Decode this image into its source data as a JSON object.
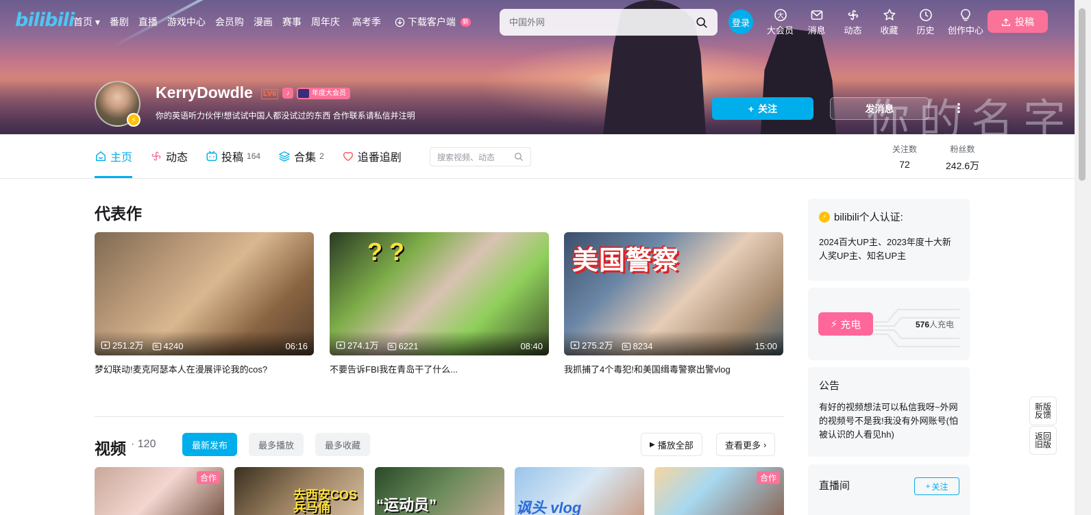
{
  "nav": {
    "logo": "bilibili",
    "links": [
      "首页",
      "番剧",
      "直播",
      "游戏中心",
      "会员购",
      "漫画",
      "赛事",
      "周年庆",
      "高考季"
    ],
    "download": "下载客户端",
    "download_badge": "新",
    "search_placeholder": "中国外网",
    "login": "登录",
    "right_items": [
      "大会员",
      "消息",
      "动态",
      "收藏",
      "历史",
      "创作中心"
    ],
    "upload": "投稿"
  },
  "banner": {
    "overlay_text": "你的名字"
  },
  "profile": {
    "name": "KerryDowdle",
    "level": "LV6",
    "vip": "年度大会员",
    "sign": "你的英语听力伙伴!想试试中国人都没试过的东西 合作联系请私信并注明",
    "follow": "关注",
    "message": "发消息"
  },
  "tabs": [
    {
      "label": "主页",
      "count": ""
    },
    {
      "label": "动态",
      "count": ""
    },
    {
      "label": "投稿",
      "count": "164"
    },
    {
      "label": "合集",
      "count": "2"
    },
    {
      "label": "追番追剧",
      "count": ""
    }
  ],
  "tab_search_placeholder": "搜索视频、动态",
  "stats": {
    "following_label": "关注数",
    "following": "72",
    "fans_label": "粉丝数",
    "fans": "242.6万"
  },
  "featured": {
    "title": "代表作",
    "items": [
      {
        "plays": "251.2万",
        "danmaku": "4240",
        "duration": "06:16",
        "title": "梦幻联动!麦克阿瑟本人在漫展评论我的cos?"
      },
      {
        "plays": "274.1万",
        "danmaku": "6221",
        "duration": "08:40",
        "title": "不要告诉FBI我在青岛干了什么..."
      },
      {
        "plays": "275.2万",
        "danmaku": "8234",
        "duration": "15:00",
        "title": "我抓捕了4个毒犯!和美国缉毒警察出警vlog",
        "overlay": "美国警察"
      }
    ]
  },
  "videos": {
    "title": "视频",
    "count": "120",
    "sort": [
      "最新发布",
      "最多播放",
      "最多收藏"
    ],
    "play_all": "播放全部",
    "more": "查看更多",
    "thumbs": [
      {
        "tag": "合作",
        "overlay": ""
      },
      {
        "tag": "",
        "overlay": "去西安COS兵马俑"
      },
      {
        "tag": "",
        "overlay": "“运动员”"
      },
      {
        "tag": "",
        "overlay": "讽头 vlog"
      },
      {
        "tag": "合作",
        "overlay": ""
      }
    ]
  },
  "sidebar": {
    "cert_title": "bilibili个人认证:",
    "cert_body": "2024百大UP主、2023年度十大新人奖UP主、知名UP主",
    "charge": "充电",
    "charge_count": "576",
    "charge_suffix": "人充电",
    "notice_title": "公告",
    "notice_body": "有好的视频想法可以私信我呀~外网的视频号不是我!我没有外网账号(怕被认识的人看见hh)",
    "live_title": "直播间",
    "live_follow": "关注"
  },
  "floats": {
    "feedback": "新版反馈",
    "back": "返回旧版"
  }
}
